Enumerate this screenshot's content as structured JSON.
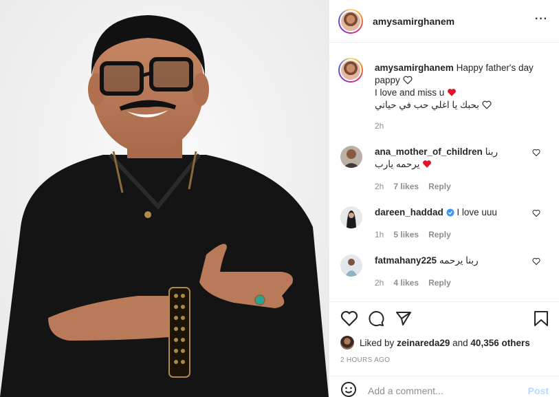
{
  "post": {
    "username": "amysamirghanem",
    "more_icon": "more-horizontal-icon"
  },
  "caption": {
    "username": "amysamirghanem",
    "line1": "Happy father's day",
    "line2": "pappy",
    "line3": "I love and miss u",
    "line4": "بحبك يا اغلي حب في حياتي",
    "time": "2h"
  },
  "comments": [
    {
      "username": "ana_mother_of_children",
      "text_part1": "ربنا",
      "text_part2": "يرحمه يارب",
      "time": "2h",
      "likes": "7 likes",
      "reply": "Reply"
    },
    {
      "username": "dareen_haddad",
      "verified": true,
      "text": "I love uuu",
      "time": "1h",
      "likes": "5 likes",
      "reply": "Reply"
    },
    {
      "username": "fatmahany225",
      "text": "ربنا يرحمه",
      "time": "2h",
      "likes": "4 likes",
      "reply": "Reply"
    }
  ],
  "actions": {
    "icons": [
      "heart-icon",
      "comment-icon",
      "share-icon",
      "bookmark-icon"
    ],
    "liked_by_prefix": "Liked by",
    "liked_by_user": "zeinareda29",
    "and": "and",
    "others_count": "40,356 others",
    "timestamp": "2 HOURS AGO"
  },
  "add_comment": {
    "placeholder": "Add a comment...",
    "post_label": "Post"
  },
  "colors": {
    "heart_red": "#ed4956",
    "verified_blue": "#3897f0",
    "post_disabled": "#b3dbff",
    "muted_text": "#8e8e8e"
  }
}
